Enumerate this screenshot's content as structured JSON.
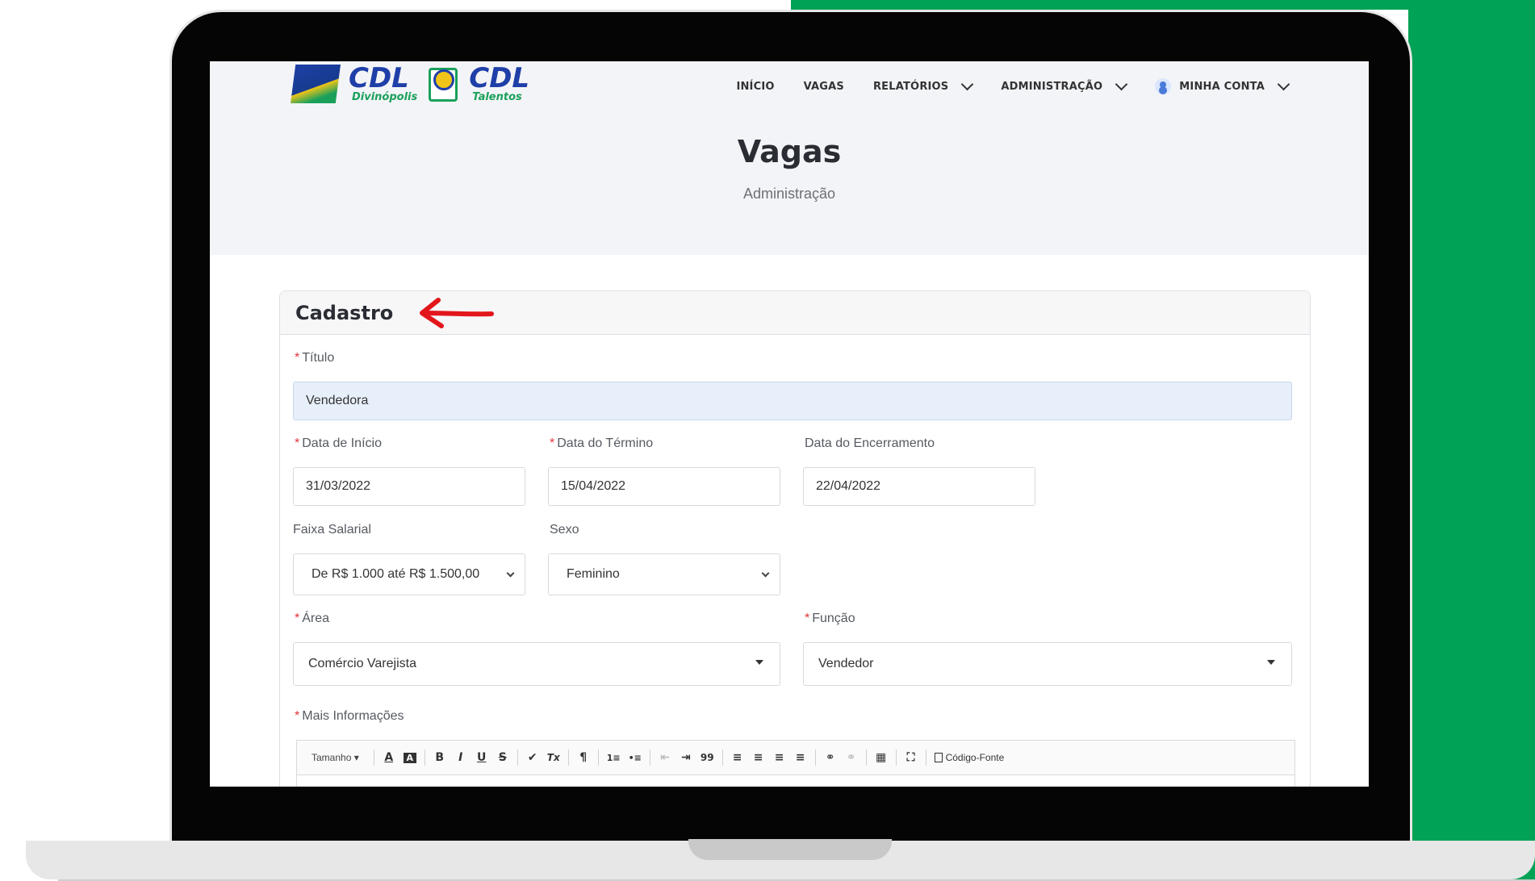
{
  "logo": {
    "brand_1": "CDL",
    "sub_1": "Divinópolis",
    "brand_2": "CDL",
    "sub_2": "Talentos"
  },
  "nav": {
    "items": [
      {
        "label": "INÍCIO"
      },
      {
        "label": "VAGAS"
      },
      {
        "label": "RELATÓRIOS"
      },
      {
        "label": "ADMINISTRAÇÃO"
      },
      {
        "label": "MINHA CONTA"
      }
    ]
  },
  "page": {
    "title": "Vagas",
    "subtitle": "Administração"
  },
  "card": {
    "title": "Cadastro"
  },
  "form": {
    "titulo": {
      "label": "Título",
      "value": "Vendedora"
    },
    "data_inicio": {
      "label": "Data de Início",
      "value": "31/03/2022"
    },
    "data_termino": {
      "label": "Data do Término",
      "value": "15/04/2022"
    },
    "data_encerramento": {
      "label": "Data do Encerramento",
      "value": "22/04/2022"
    },
    "faixa_salarial": {
      "label": "Faixa Salarial",
      "value": "De R$ 1.000 até R$ 1.500,00"
    },
    "sexo": {
      "label": "Sexo",
      "value": "Feminino"
    },
    "area": {
      "label": "Área",
      "value": "Comércio Varejista"
    },
    "funcao": {
      "label": "Função",
      "value": "Vendedor"
    },
    "mais_informacoes": {
      "label": "Mais Informações"
    },
    "required_marker": "*"
  },
  "editor": {
    "size_label": "Tamanho",
    "source_label": "Código-Fonte",
    "buttons": [
      "A",
      "A",
      "B",
      "I",
      "U",
      "S",
      "✔",
      "Tx",
      "¶",
      "1≡",
      "•≡",
      "⇤",
      "⇥",
      "99",
      "≡",
      "≡",
      "≡",
      "≡",
      "⚭",
      "⚭",
      "▦",
      "⛶"
    ]
  },
  "colors": {
    "accent_green": "#00a256",
    "hero_bg": "#f3f4f7",
    "annotation_arrow": "#e3161b",
    "filled_input": "#e7effa"
  }
}
